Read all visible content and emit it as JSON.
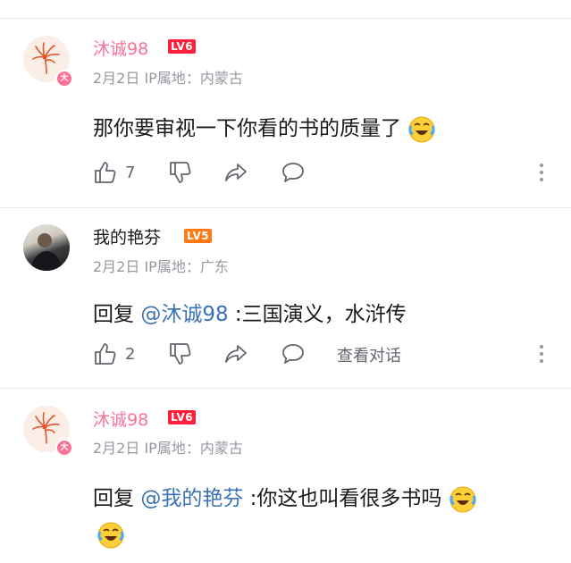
{
  "comments": [
    {
      "user": "沐诚98",
      "level": "LV6",
      "avatar_badge": "大",
      "meta": "2月2日 IP属地：内蒙古",
      "text": "那你要审视一下你看的书的质量了",
      "likes": "7",
      "emoji": "laugh-cry-emoji"
    },
    {
      "user": "我的艳芬",
      "level": "LV5",
      "meta": "2月2日 IP属地：广东",
      "reply_prefix": "回复",
      "mention": "@沐诚98",
      "text": ":三国演义，水浒传",
      "likes": "2",
      "view_conversation": "查看对话"
    },
    {
      "user": "沐诚98",
      "level": "LV6",
      "avatar_badge": "大",
      "meta": "2月2日 IP属地：内蒙古",
      "reply_prefix": "回复",
      "mention": "@我的艳芬",
      "text": ":你这也叫看很多书吗",
      "emoji": "laugh-cry-emoji"
    }
  ],
  "colors": {
    "vip_pink": "#fb7299",
    "mention_blue": "#3a72b6",
    "lv6_red": "#ff1f3d",
    "lv5_orange": "#ff7a14",
    "meta_gray": "#9499a0"
  },
  "icons": [
    "like-icon",
    "dislike-icon",
    "share-icon",
    "comment-icon",
    "more-icon"
  ]
}
